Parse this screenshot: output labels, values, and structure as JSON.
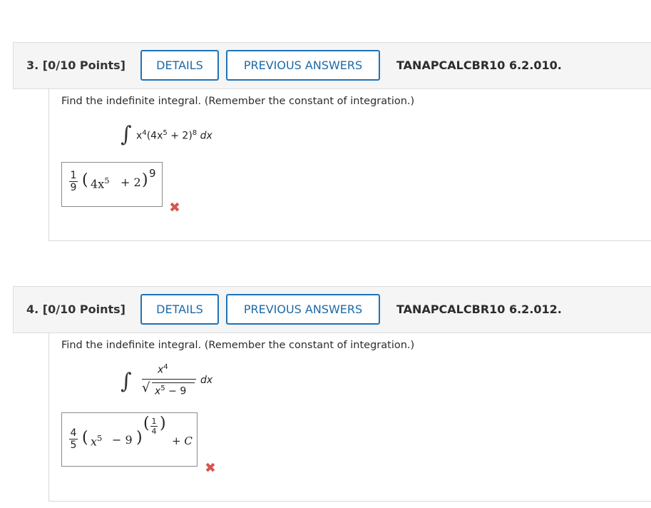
{
  "questions": [
    {
      "number_label": "3. [0/10 Points]",
      "details_label": "DETAILS",
      "previous_answers_label": "PREVIOUS ANSWERS",
      "code": "TANAPCALCBR10 6.2.010.",
      "prompt": "Find the indefinite integral. (Remember the constant of integration.)",
      "integral": {
        "sign": "∫",
        "base": "x",
        "exp1": "4",
        "inner_open": "(4x",
        "exp2": "5",
        "inner_rest": " + 2)",
        "exp3": "8",
        "dx": "dx"
      },
      "answer": {
        "num": "1",
        "den": "9",
        "open": "(",
        "term": "4x",
        "exp": "5",
        "rest": "+ 2",
        "close": ")",
        "power": "9"
      },
      "status_icon": "incorrect-x"
    },
    {
      "number_label": "4. [0/10 Points]",
      "details_label": "DETAILS",
      "previous_answers_label": "PREVIOUS ANSWERS",
      "code": "TANAPCALCBR10 6.2.012.",
      "prompt": "Find the indefinite integral. (Remember the constant of integration.)",
      "integral": {
        "sign": "∫",
        "numerator": "x",
        "num_exp": "4",
        "radicand": "x",
        "rad_exp": "5",
        "rad_rest": " − 9",
        "dx": "dx"
      },
      "answer": {
        "num": "4",
        "den": "5",
        "open": "(",
        "term": "x",
        "exp": "5",
        "rest": "− 9",
        "close": ")",
        "pow_num": "1",
        "pow_den": "4",
        "plus_c": "+ C"
      },
      "status_icon": "incorrect-x"
    }
  ],
  "colors": {
    "accent": "#1f73b7",
    "incorrect": "#d9534f",
    "header_bg": "#f5f5f5"
  }
}
